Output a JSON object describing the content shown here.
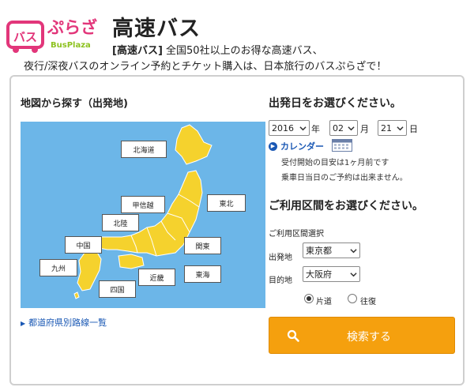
{
  "header": {
    "logo_main": "バス",
    "logo_kana": "ぷらざ",
    "logo_sub": "BusPlaza",
    "title": "高速バス",
    "lead_tag": "[高速バス]",
    "lead_line1": "全国50社以上のお得な高速バス、",
    "lead_line2": "夜行/深夜バスのオンライン予約とチケット購入は、日本旅行のバスぷらざで！"
  },
  "map": {
    "heading": "地図から探す（出発地)",
    "regions": {
      "hokkaido": "北海道",
      "tohoku": "東北",
      "koshinetsu": "甲信越",
      "hokuriku": "北陸",
      "kanto": "関東",
      "chugoku": "中国",
      "kyushu": "九州",
      "shikoku": "四国",
      "kinki": "近畿",
      "tokai": "東海"
    },
    "land_color": "#f5d22d",
    "sea_color": "#6cb6e8",
    "route_link": "都道府県別路線一覧"
  },
  "date": {
    "heading": "出発日をお選びください。",
    "year": "2016",
    "year_unit": "年",
    "month": "02",
    "month_unit": "月",
    "day": "21",
    "day_unit": "日",
    "calendar_label": "カレンダー",
    "note1": "受付開始の目安は1ヶ月前です",
    "note2": "乗車日当日のご予約は出来ません。"
  },
  "route": {
    "heading": "ご利用区間をお選びください。",
    "sub_label": "ご利用区間選択",
    "departure_label": "出発地",
    "departure_value": "東京都",
    "destination_label": "目的地",
    "destination_value": "大阪府",
    "trip_oneway": "片道",
    "trip_round": "往復",
    "selected": "oneway"
  },
  "search": {
    "button_label": "検索する",
    "button_color": "#f5a00e"
  }
}
